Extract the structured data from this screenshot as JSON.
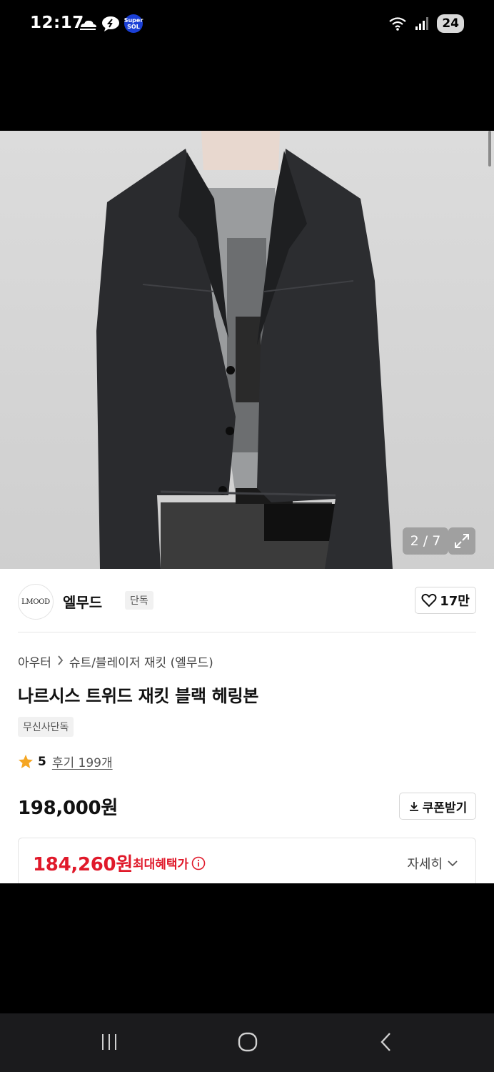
{
  "status_bar": {
    "time": "12:17",
    "icons_left": [
      "cloud-weather-icon",
      "chat-bubble-icon",
      "super-sol-icon"
    ],
    "sol_badge_lines": [
      "Super",
      "SOL"
    ],
    "icons_right": [
      "wifi-icon",
      "signal-icon"
    ],
    "battery": "24"
  },
  "gallery": {
    "counter": "2 / 7",
    "expand_icon": "expand-icon"
  },
  "brand": {
    "logo_text": "LMOOD",
    "name": "엘무드",
    "tag": "단독",
    "likes": "17만"
  },
  "breadcrumb": {
    "parent": "아우터",
    "child": "슈트/블레이저 재킷 (엘무드)"
  },
  "product": {
    "title": "나르시스 트위드 재킷 블랙 헤링본",
    "badge": "무신사단독",
    "rating": "5",
    "review_text": "후기 199개",
    "price": "198,000원",
    "coupon_label": "쿠폰받기"
  },
  "benefit": {
    "price": "184,260원",
    "label": "최대혜택가",
    "detail_label": "자세히"
  },
  "colors": {
    "accent_red": "#e0192a",
    "star": "#f5a623"
  }
}
